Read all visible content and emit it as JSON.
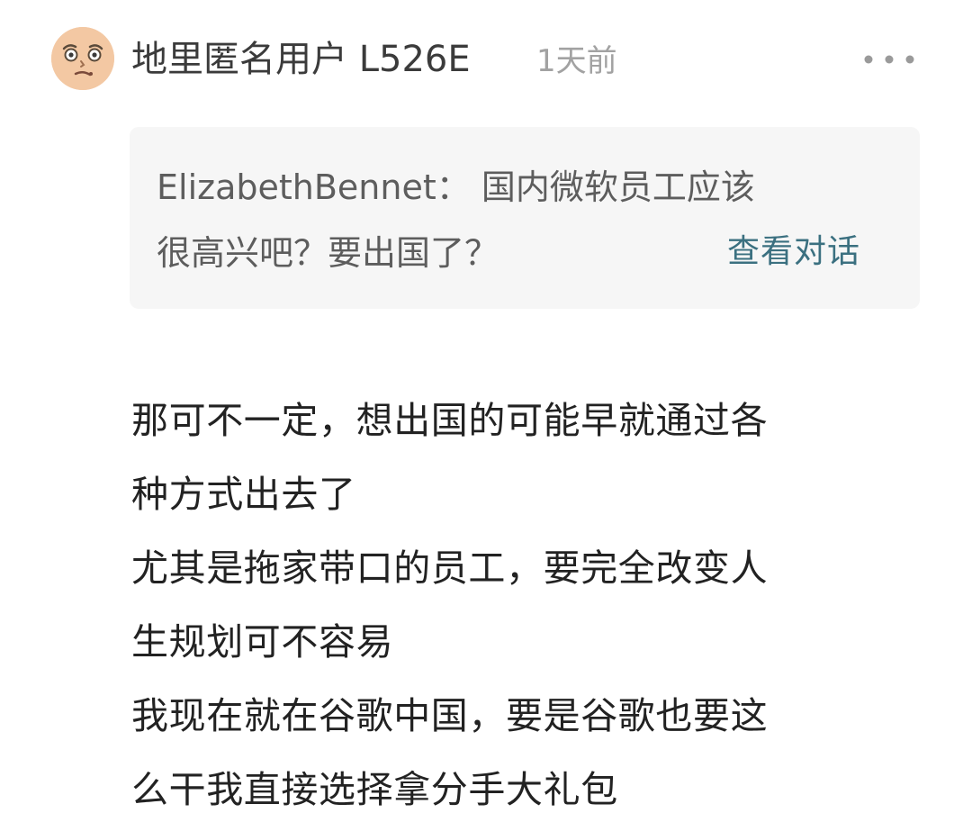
{
  "comment": {
    "username": "地里匿名用户 L526E",
    "timestamp": "1天前",
    "more_icon": "more-horizontal-icon",
    "avatar_icon": "face-avatar-icon",
    "quote": {
      "lines": [
        "ElizabethBennet： 国内微软员工应该",
        "很高兴吧？要出国了？"
      ],
      "view_conversation_label": "查看对话"
    },
    "body_lines": [
      "那可不一定，想出国的可能早就通过各",
      "种方式出去了",
      "尤其是拖家带口的员工，要完全改变人",
      "生规划可不容易",
      "我现在就在谷歌中国，要是谷歌也要这",
      "么干我直接选择拿分手大礼包"
    ]
  },
  "colors": {
    "username": "#3b3b3b",
    "timestamp": "#a2a2a2",
    "quote_background": "#f6f6f6",
    "quote_text": "#5d5d5d",
    "link": "#3b7080",
    "body_text": "#222222",
    "avatar": "#f3c8a3"
  }
}
